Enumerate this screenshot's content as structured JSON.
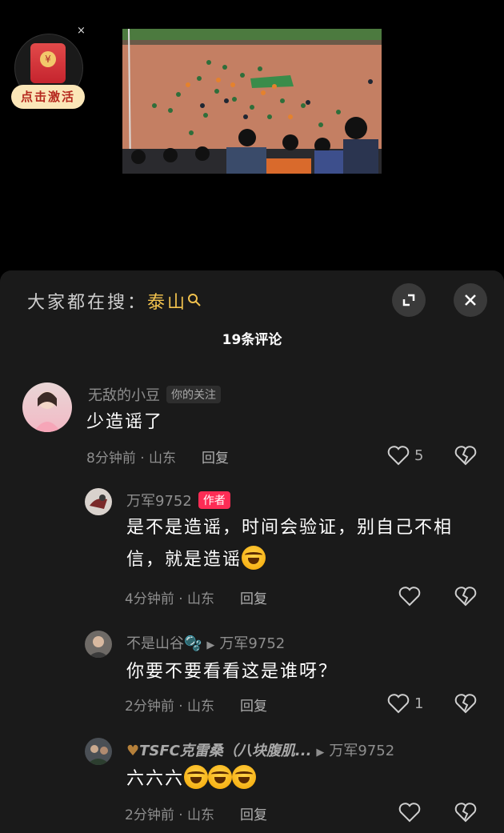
{
  "red_packet": {
    "label": "点击激活",
    "close": "×"
  },
  "sheet": {
    "search_prefix": "大家都在搜：",
    "search_keyword": "泰山",
    "comment_count": "19条评论"
  },
  "comments": [
    {
      "username": "无敌的小豆",
      "tag": "你的关注",
      "text": "少造谣了",
      "time_location": "8分钟前 · 山东",
      "reply": "回复",
      "likes": "5"
    },
    {
      "username": "万军9752",
      "tag": "作者",
      "text": "是不是造谣，时间会验证，别自己不相信，就是造谣",
      "time_location": "4分钟前 · 山东",
      "reply": "回复",
      "likes": ""
    },
    {
      "username": "不是山谷🫧",
      "reply_to": "万军9752",
      "text": "你要不要看看这是谁呀？",
      "time_location": "2分钟前 · 山东",
      "reply": "回复",
      "likes": "1"
    },
    {
      "username": "TSFC克雷桑（八块腹肌...",
      "reply_to": "万军9752",
      "text": "六六六",
      "time_location": "2分钟前 · 山东",
      "reply": "回复",
      "likes": ""
    }
  ],
  "icons": {
    "expand": "expand-icon",
    "close": "close-icon",
    "like": "heart-icon",
    "dislike": "broken-heart-icon",
    "search": "search-icon"
  },
  "colors": {
    "accent_keyword": "#f2c24e",
    "author_tag": "#fe2c55"
  }
}
